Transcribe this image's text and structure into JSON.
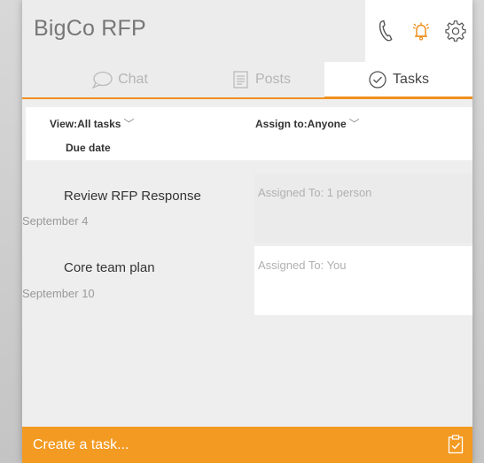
{
  "app": {
    "title": "BigCo RFP"
  },
  "header_icons": [
    {
      "name": "phone-icon"
    },
    {
      "name": "bell-icon",
      "color": "#f0901e"
    },
    {
      "name": "gear-icon"
    }
  ],
  "tabs": [
    {
      "label": "Chat",
      "icon": "chat-bubble-icon",
      "active": false
    },
    {
      "label": "Posts",
      "icon": "document-icon",
      "active": false
    },
    {
      "label": "Tasks",
      "icon": "check-circle-icon",
      "active": true
    }
  ],
  "filters": {
    "view_label": "View:All tasks",
    "assign_label": "Assign to:Anyone",
    "sort_label": "Due date"
  },
  "tasks": [
    {
      "title": "Review RFP Response",
      "date": "September 4",
      "assigned": "Assigned To: 1 person"
    },
    {
      "title": "Core team plan",
      "date": "September 10",
      "assigned": "Assigned To: You"
    }
  ],
  "footer": {
    "create_label": "Create a task...",
    "icon": "clipboard-check-icon"
  },
  "colors": {
    "accent": "#f0901e",
    "footer_bg": "#f39a22",
    "panel_bg": "#eeeeee",
    "text_muted": "#999999"
  }
}
